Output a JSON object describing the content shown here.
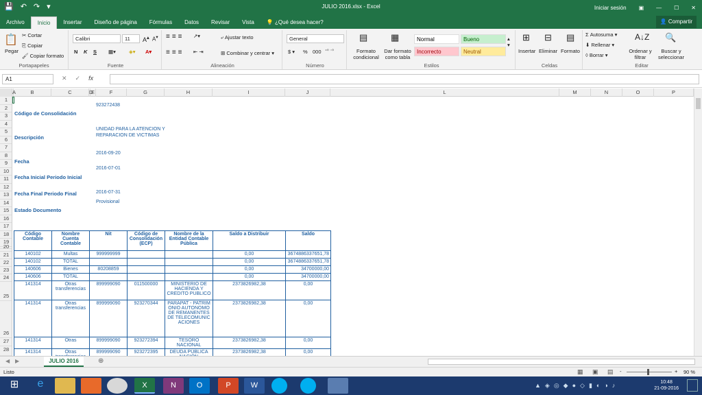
{
  "window": {
    "title": "JULIO 2016.xlsx - Excel",
    "sign_in": "Iniciar sesión",
    "share": "Compartir"
  },
  "tabs": [
    "Archivo",
    "Inicio",
    "Insertar",
    "Diseño de página",
    "Fórmulas",
    "Datos",
    "Revisar",
    "Vista"
  ],
  "tell_me": "¿Qué desea hacer?",
  "ribbon": {
    "portapapeles": {
      "label": "Portapapeles",
      "paste": "Pegar",
      "cut": "Cortar",
      "copy": "Copiar",
      "format_painter": "Copiar formato"
    },
    "fuente": {
      "label": "Fuente",
      "font": "Calibri",
      "size": "11",
      "bold": "N",
      "italic": "K",
      "underline": "S"
    },
    "alineacion": {
      "label": "Alineación",
      "wrap": "Ajustar texto",
      "merge": "Combinar y centrar"
    },
    "numero": {
      "label": "Número",
      "format": "General",
      "percent": "%",
      "thousands": "000"
    },
    "estilos": {
      "label": "Estilos",
      "cond_format": "Formato condicional",
      "table_format": "Dar formato como tabla",
      "styles": [
        {
          "name": "Normal",
          "bg": "#ffffff",
          "fg": "#000000"
        },
        {
          "name": "Bueno",
          "bg": "#c6efce",
          "fg": "#006100"
        },
        {
          "name": "Incorrecto",
          "bg": "#ffc7ce",
          "fg": "#9c0006"
        },
        {
          "name": "Neutral",
          "bg": "#ffeb9c",
          "fg": "#9c5700"
        }
      ]
    },
    "celdas": {
      "label": "Celdas",
      "insert": "Insertar",
      "delete": "Eliminar",
      "format": "Formato"
    },
    "edicion": {
      "label": "Editar",
      "autosum": "Autosuma",
      "fill": "Rellenar",
      "clear": "Borrar",
      "sort": "Ordenar y filtrar",
      "find": "Buscar y seleccionar"
    }
  },
  "formula_bar": {
    "cell": "A1",
    "cancel": "✕",
    "enter": "✓",
    "fx": "fx",
    "value": ""
  },
  "columns": [
    "A",
    "B",
    "C",
    "D",
    "E",
    "F",
    "G",
    "H",
    "I",
    "J",
    "L",
    "M",
    "N",
    "O",
    "P"
  ],
  "rows": [
    "1",
    "2",
    "3",
    "4",
    "5",
    "6",
    "7",
    "8",
    "9",
    "10",
    "11",
    "12",
    "13",
    "14",
    "15",
    "16",
    "17",
    "18",
    "19",
    "20",
    "21",
    "22",
    "23",
    "24",
    "25",
    "26",
    "27",
    "28"
  ],
  "labels": {
    "consolidacion": "Código de Consolidación",
    "descripcion": "Descripción",
    "fecha": "Fecha",
    "fecha_inicial": "Fecha Inicial Periodo Inicial",
    "fecha_final": "Fecha Final Periodo Final",
    "estado": "Estado Documento"
  },
  "values": {
    "consolidacion": "923272438",
    "descripcion_1": "UNIDAD PARA LA ATENCION Y",
    "descripcion_2": "REPARACION DE VICTIMAS",
    "fecha": "2016-09-20",
    "fecha_inicial": "2016-07-01",
    "fecha_final": "2016-07-31",
    "estado": "Provisional"
  },
  "table": {
    "headers": [
      "Código Contable",
      "Nombre Cuenta Contable",
      "Nit",
      "Código de Consolidación (ECP)",
      "Nombre de la Entidad Contable Pública",
      "Saldo a Distribuir",
      "Saldo"
    ],
    "rows": [
      [
        "140102",
        "Multas",
        "999999999",
        "",
        "",
        "0,00",
        "3674886337651,78"
      ],
      [
        "140102",
        "TOTAL",
        "",
        "",
        "",
        "0,00",
        "3674886337651,78"
      ],
      [
        "140606",
        "Bienes",
        "80208859",
        "",
        "",
        "0,00",
        "34700000,00"
      ],
      [
        "140606",
        "TOTAL",
        "",
        "",
        "",
        "0,00",
        "34700000,00"
      ],
      [
        "141314",
        "Otras transferencias",
        "899999090",
        "011500000",
        "MINISTERIO DE HACIENDA Y CREDITO PUBLICO",
        "2373826982,38",
        "0,00"
      ],
      [
        "141314",
        "Otras transferencias",
        "899999090",
        "923270344",
        "PARAPAT - PATRIMONIO AUTONOMO DE REMANENTES DE TELECOMUNICACIONES",
        "2373826982,38",
        "0,00"
      ],
      [
        "141314",
        "Otras",
        "899999090",
        "923272394",
        "TESORO NACIONAL",
        "2373826982,38",
        "0,00"
      ],
      [
        "141314",
        "Otras transferencias",
        "899999090",
        "923272395",
        "DEUDA PÚBLICA NACIÓN",
        "2373826982,38",
        "0,00"
      ]
    ]
  },
  "sheet_tab": "JULIO 2016",
  "status": {
    "ready": "Listo",
    "zoom": "90 %",
    "minus": "-",
    "plus": "+"
  },
  "taskbar": {
    "time": "10:48",
    "date": "21-09-2016"
  }
}
